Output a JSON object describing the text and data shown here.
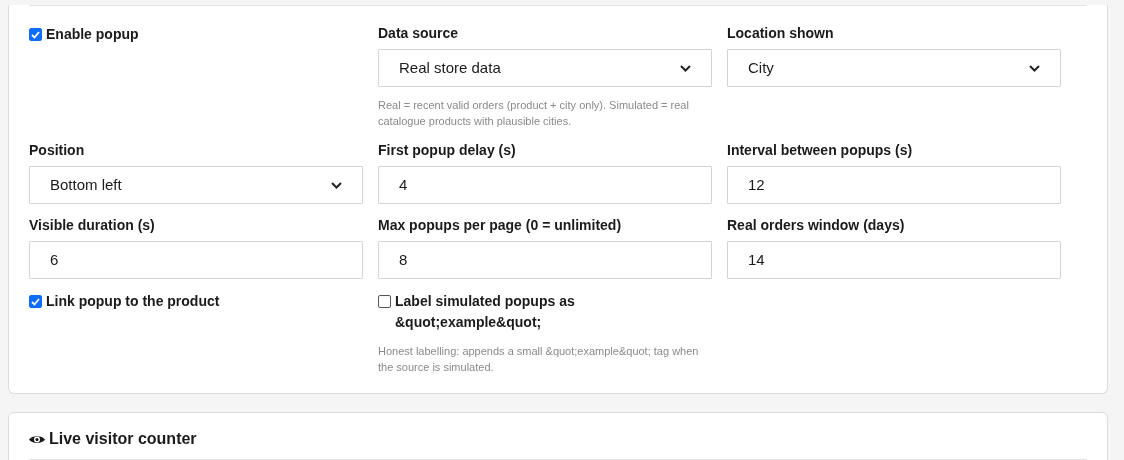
{
  "fields": [
    {
      "kind": "checkbox",
      "label": "Enable popup",
      "checked": true
    },
    {
      "kind": "select",
      "label": "Data source",
      "value": "Real store data",
      "help": "Real = recent valid orders (product + city only). Simulated = real catalogue products with plausible cities."
    },
    {
      "kind": "select",
      "label": "Location shown",
      "value": "City"
    },
    {
      "kind": "select",
      "label": "Position",
      "value": "Bottom left"
    },
    {
      "kind": "number",
      "label": "First popup delay (s)",
      "value": "4"
    },
    {
      "kind": "number",
      "label": "Interval between popups (s)",
      "value": "12"
    },
    {
      "kind": "number",
      "label": "Visible duration (s)",
      "value": "6"
    },
    {
      "kind": "number",
      "label": "Max popups per page (0 = unlimited)",
      "value": "8"
    },
    {
      "kind": "number",
      "label": "Real orders window (days)",
      "value": "14"
    },
    {
      "kind": "checkbox",
      "label": "Link popup to the product",
      "checked": true
    },
    {
      "kind": "checkbox",
      "label": "Label simulated popups as &quot;example&quot;",
      "checked": false,
      "help": "Honest labelling: appends a small &quot;example&quot; tag when the source is simulated."
    }
  ],
  "next_section": {
    "title": "Live visitor counter"
  }
}
